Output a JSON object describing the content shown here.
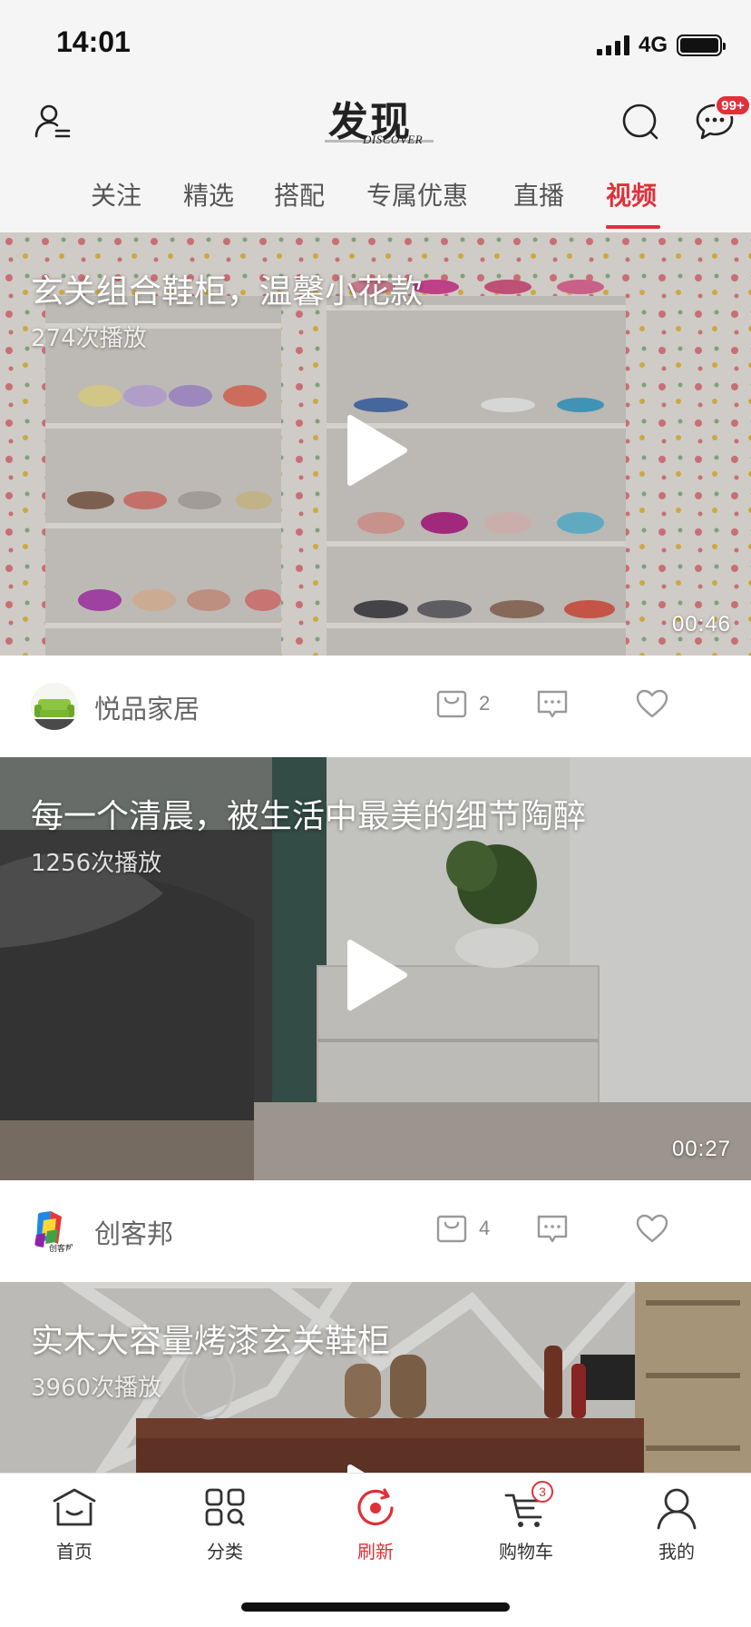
{
  "status_bar": {
    "time": "14:01",
    "network": "4G"
  },
  "header": {
    "logo_text": "发现",
    "logo_sub": "DISCOVER",
    "message_badge": "99+"
  },
  "tabs": [
    {
      "label": "关注",
      "active": false
    },
    {
      "label": "精选",
      "active": false
    },
    {
      "label": "搭配",
      "active": false
    },
    {
      "label": "专属优惠",
      "active": false
    },
    {
      "label": "直播",
      "active": false
    },
    {
      "label": "视频",
      "active": true
    }
  ],
  "videos": [
    {
      "title": "玄关组合鞋柜，温馨小花款",
      "plays": "274次播放",
      "duration": "00:46",
      "author": "悦品家居",
      "product_count": "2"
    },
    {
      "title": "每一个清晨，被生活中最美的细节陶醉",
      "plays": "1256次播放",
      "duration": "00:27",
      "author": "创客邦",
      "product_count": "4"
    },
    {
      "title": "实木大容量烤漆玄关鞋柜",
      "plays": "3960次播放"
    }
  ],
  "bottom_nav": [
    {
      "label": "首页",
      "icon": "home-icon"
    },
    {
      "label": "分类",
      "icon": "category-icon"
    },
    {
      "label": "刷新",
      "icon": "refresh-icon",
      "active": true
    },
    {
      "label": "购物车",
      "icon": "cart-icon",
      "badge": "3"
    },
    {
      "label": "我的",
      "icon": "profile-icon"
    }
  ],
  "colors": {
    "accent": "#e0303a",
    "background": "#f5f5f5"
  }
}
